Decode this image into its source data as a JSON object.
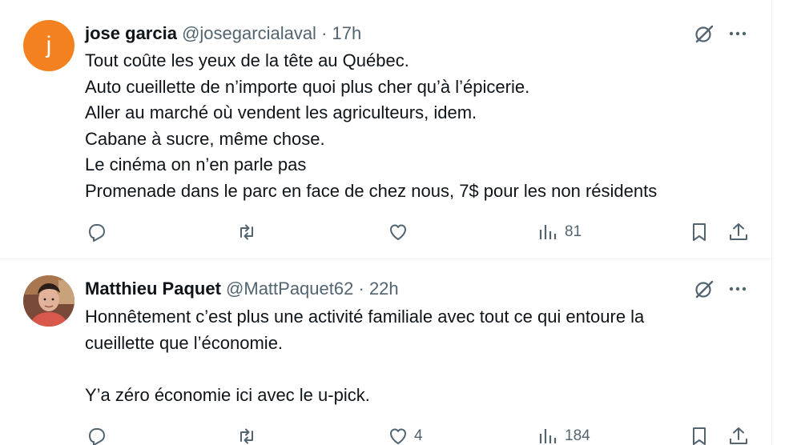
{
  "tweets": [
    {
      "avatar_letter": "j",
      "avatar_color": "#f4811f",
      "name": "jose garcia",
      "handle": "@josegarcialaval",
      "separator": "·",
      "time": "17h",
      "lines": [
        "Tout coûte les yeux de la tête au Québec.",
        "Auto cueillette de n’importe quoi plus cher qu’à l’épicerie.",
        "Aller au marché où vendent les agriculteurs, idem.",
        "Cabane à sucre, même chose.",
        "Le cinéma on n’en parle pas",
        "Promenade dans le parc en face de chez nous, 7$ pour les non résidents"
      ],
      "views": "81"
    },
    {
      "name": "Matthieu Paquet",
      "handle": "@MattPaquet62",
      "separator": "·",
      "time": "22h",
      "lines": [
        "Honnêtement c’est plus une activité familiale avec tout ce qui entoure la",
        "cueillette que l’économie.",
        "",
        "Y’a zéro économie ici avec le u-pick."
      ],
      "likes": "4",
      "views": "184"
    }
  ],
  "icons": {
    "reply": "reply-icon",
    "repost": "repost-icon",
    "like": "like-icon",
    "views": "views-icon",
    "bookmark": "bookmark-icon",
    "share": "share-icon",
    "grok": "grok-icon",
    "more": "more-icon"
  },
  "colors": {
    "text": "#0f1419",
    "secondary": "#536471",
    "divider": "#eff3f4"
  }
}
